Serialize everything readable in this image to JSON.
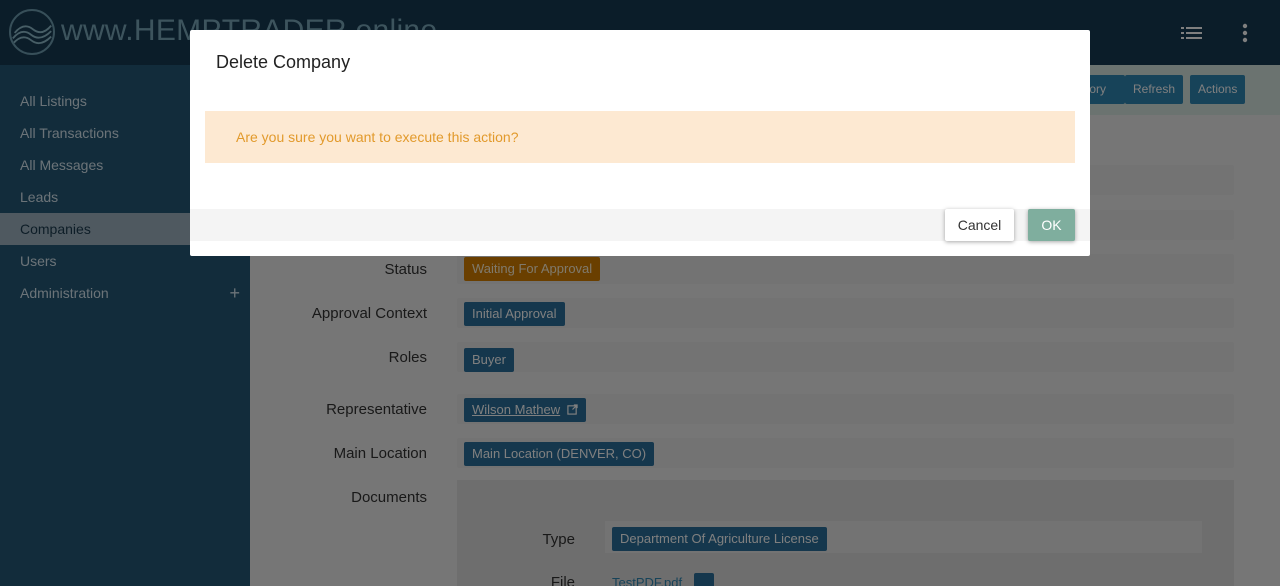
{
  "app": {
    "brand": "www.HEMPTRADER.online",
    "logo_icon": "wave-logo-icon",
    "list_icon": "list-icon",
    "more_icon": "more-vertical-icon"
  },
  "sidebar": {
    "items": [
      {
        "label": "All Listings"
      },
      {
        "label": "All Transactions"
      },
      {
        "label": "All Messages"
      },
      {
        "label": "Leads"
      },
      {
        "label": "Companies",
        "active": true
      },
      {
        "label": "Users"
      },
      {
        "label": "Administration",
        "expand_icon": "+"
      }
    ]
  },
  "toolbar": {
    "history_label": "tory",
    "refresh_label": "Refresh",
    "actions_label": "Actions"
  },
  "details": {
    "status": {
      "label": "Status",
      "value": "Waiting For Approval"
    },
    "approval_context": {
      "label": "Approval Context",
      "value": "Initial Approval"
    },
    "roles": {
      "label": "Roles",
      "value": "Buyer"
    },
    "representative": {
      "label": "Representative",
      "value": "Wilson Mathew"
    },
    "main_location": {
      "label": "Main Location",
      "value": "Main Location (DENVER, CO)"
    },
    "documents": {
      "label": "Documents",
      "type_label": "Type",
      "type_value": "Department Of Agriculture License",
      "file_label": "File",
      "file_value": "TestPDF.pdf"
    }
  },
  "modal": {
    "title": "Delete Company",
    "message": "Are you sure you want to execute this action?",
    "cancel_label": "Cancel",
    "ok_label": "OK"
  },
  "colors": {
    "topbar": "#173a52",
    "sidebar": "#245876",
    "ok_button": "#7fae9e",
    "alert_bg": "#fde9d2",
    "alert_text": "#e29a2c"
  }
}
